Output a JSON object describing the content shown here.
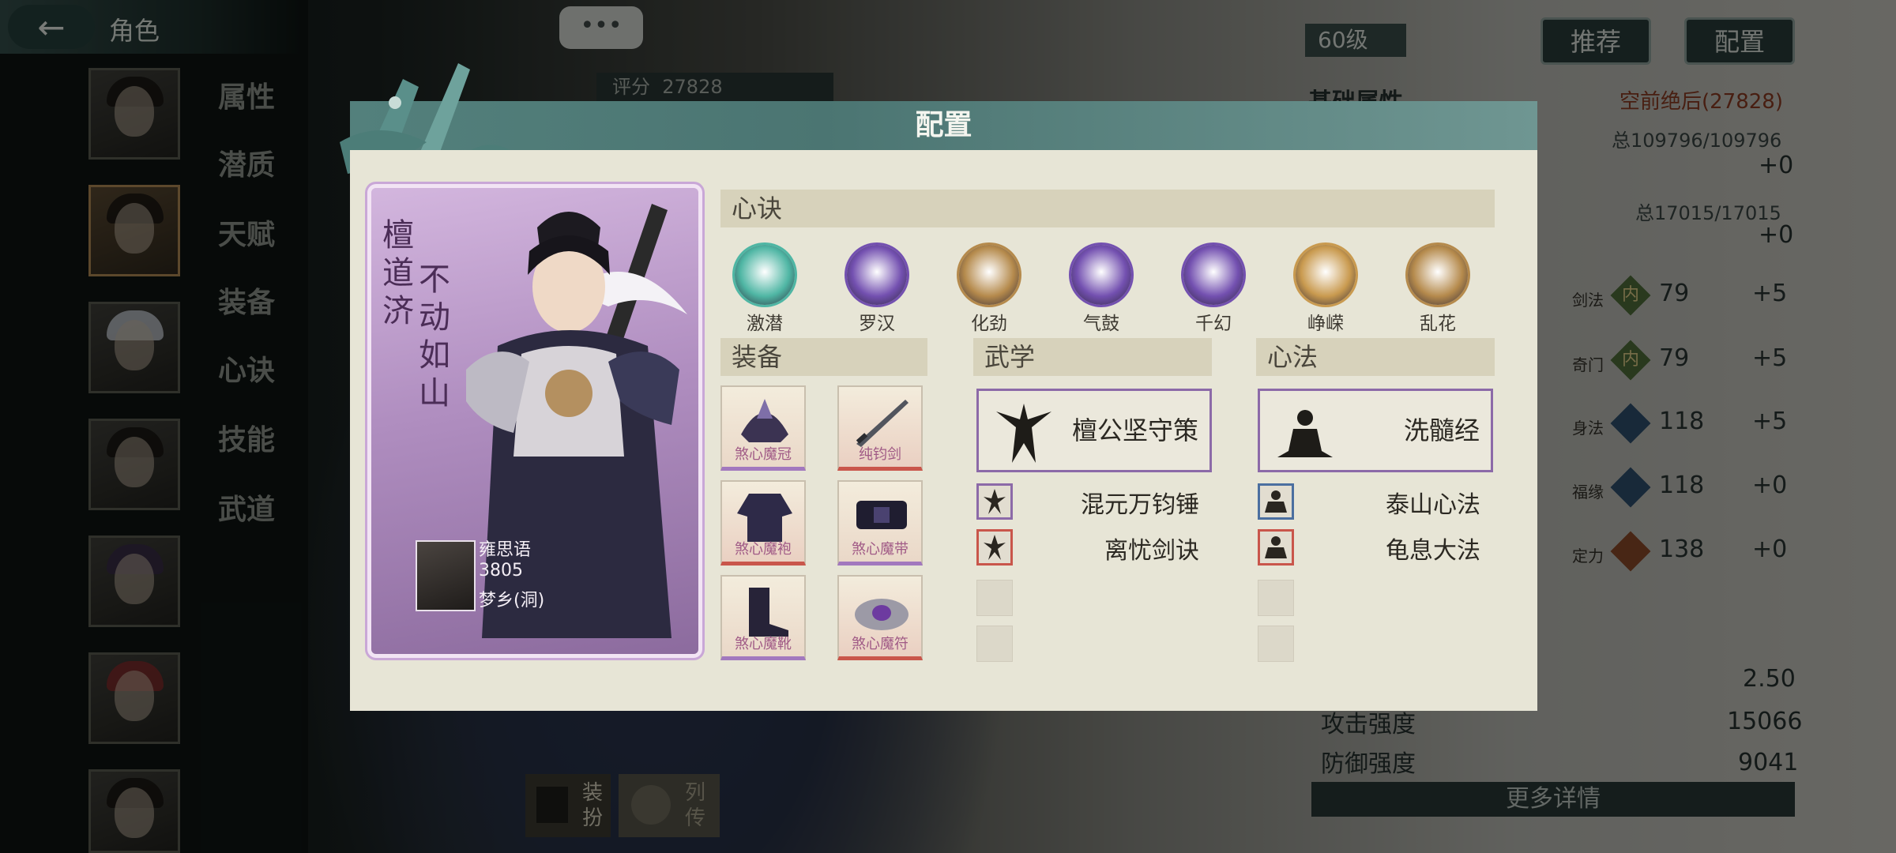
{
  "header": {
    "back_icon": "arrow-left-icon",
    "title": "角色"
  },
  "sidebar": {
    "menu": [
      "属性",
      "潜质",
      "天赋",
      "装备",
      "心诀",
      "技能",
      "武道"
    ]
  },
  "background_panel": {
    "level": "60级",
    "recommend_button": "推荐",
    "config_button": "配置",
    "basic_attr_label": "基础属性",
    "rank_label": "空前绝后(27828)",
    "total_a": "总109796/109796",
    "delta_a": "+0",
    "total_b": "总17015/17015",
    "delta_b": "+0",
    "stats": [
      {
        "name": "剑法",
        "badge": "内",
        "value": "79",
        "delta": "+5"
      },
      {
        "name": "奇门",
        "badge": "内",
        "value": "79",
        "delta": "+5"
      },
      {
        "name": "身法",
        "badge": "",
        "value": "118",
        "delta": "+5"
      },
      {
        "name": "福缘",
        "badge": "",
        "value": "118",
        "delta": "+0"
      },
      {
        "name": "定力",
        "badge": "",
        "value": "138",
        "delta": "+0"
      }
    ],
    "speed_value": "2.50",
    "attack_label": "攻击强度",
    "attack_value": "15066",
    "defense_label": "防御强度",
    "defense_value": "9041",
    "more_details": "更多详情",
    "score_label": "评分",
    "score_value": "27828",
    "chat_bubble": "•••",
    "tab_dress": "装扮",
    "tab_biography": "列传"
  },
  "modal": {
    "title": "配置",
    "character": {
      "name": "檀道济",
      "motto": "不动如山",
      "owner_name": "雍思语",
      "owner_power": "3805",
      "owner_server": "梦乡(洞)"
    },
    "mind_section": {
      "title": "心诀",
      "items": [
        {
          "label": "激潜",
          "color": "#4fb6a4"
        },
        {
          "label": "罗汉",
          "color": "#7350b0"
        },
        {
          "label": "化劲",
          "color": "#b58a4c"
        },
        {
          "label": "气鼓",
          "color": "#7350b0"
        },
        {
          "label": "千幻",
          "color": "#7350b0"
        },
        {
          "label": "峥嵘",
          "color": "#c99a4f"
        },
        {
          "label": "乱花",
          "color": "#b58a4c"
        }
      ]
    },
    "equipment_section": {
      "title": "装备",
      "items": [
        {
          "label": "煞心魔冠",
          "rarity": "purple"
        },
        {
          "label": "纯钧剑",
          "rarity": "red"
        },
        {
          "label": "煞心魔袍",
          "rarity": "red"
        },
        {
          "label": "煞心魔带",
          "rarity": "purple"
        },
        {
          "label": "煞心魔靴",
          "rarity": "purple"
        },
        {
          "label": "煞心魔符",
          "rarity": "red"
        }
      ]
    },
    "martial_section": {
      "title": "武学",
      "main": "檀公坚守策",
      "skills": [
        "混元万钧锤",
        "离忧剑诀"
      ]
    },
    "heart_section": {
      "title": "心法",
      "main": "洗髓经",
      "skills": [
        "泰山心法",
        "龟息大法"
      ]
    }
  },
  "colors": {
    "modal_header": "#53807c",
    "modal_body": "#e7e5d6",
    "section_bg": "#d7d2bb",
    "card_purple": "#b08ec0"
  }
}
